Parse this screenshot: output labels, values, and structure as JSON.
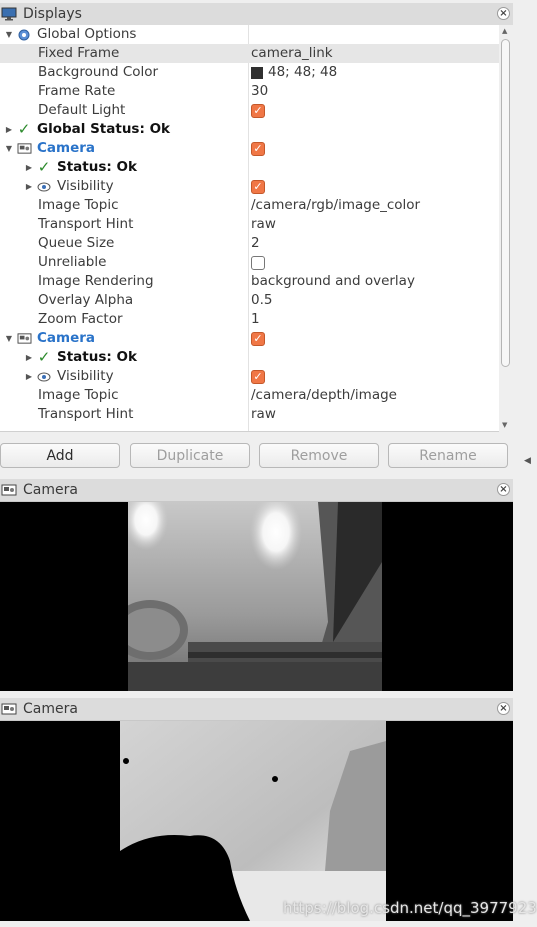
{
  "displays_panel": {
    "title": "Displays"
  },
  "tree": [
    {
      "indent": 0,
      "arrow": "▼",
      "icon": "gear-icon",
      "name": "Global Options",
      "value": ""
    },
    {
      "indent": 1,
      "name": "Fixed Frame",
      "value": "camera_link",
      "selected": true
    },
    {
      "indent": 1,
      "name": "Background Color",
      "value": "48; 48; 48",
      "swatch": "#303030"
    },
    {
      "indent": 1,
      "name": "Frame Rate",
      "value": "30"
    },
    {
      "indent": 1,
      "name": "Default Light",
      "check": true
    },
    {
      "indent": 0,
      "arrow": "▶",
      "icon": "checkmark-icon",
      "name": "Global Status: Ok",
      "style": "bold"
    },
    {
      "indent": 0,
      "arrow": "▼",
      "icon": "camera-display-icon",
      "name": "Camera",
      "style": "blue",
      "check": true
    },
    {
      "indent": 1,
      "arrow": "▶",
      "icon": "checkmark-icon",
      "name": "Status: Ok",
      "style": "bold"
    },
    {
      "indent": 1,
      "arrow": "▶",
      "icon": "eye-icon",
      "name": "Visibility",
      "check": true
    },
    {
      "indent": 1,
      "name": "Image Topic",
      "value": "/camera/rgb/image_color"
    },
    {
      "indent": 1,
      "name": "Transport Hint",
      "value": "raw"
    },
    {
      "indent": 1,
      "name": "Queue Size",
      "value": "2"
    },
    {
      "indent": 1,
      "name": "Unreliable",
      "check": false
    },
    {
      "indent": 1,
      "name": "Image Rendering",
      "value": "background and overlay"
    },
    {
      "indent": 1,
      "name": "Overlay Alpha",
      "value": "0.5"
    },
    {
      "indent": 1,
      "name": "Zoom Factor",
      "value": "1"
    },
    {
      "indent": 0,
      "arrow": "▼",
      "icon": "camera-display-icon",
      "name": "Camera",
      "style": "blue",
      "check": true
    },
    {
      "indent": 1,
      "arrow": "▶",
      "icon": "checkmark-icon",
      "name": "Status: Ok",
      "style": "bold"
    },
    {
      "indent": 1,
      "arrow": "▶",
      "icon": "eye-icon",
      "name": "Visibility",
      "check": true
    },
    {
      "indent": 1,
      "name": "Image Topic",
      "value": "/camera/depth/image"
    },
    {
      "indent": 1,
      "name": "Transport Hint",
      "value": "raw"
    }
  ],
  "buttons": {
    "add": "Add",
    "duplicate": "Duplicate",
    "remove": "Remove",
    "rename": "Rename"
  },
  "camera_panel_1": {
    "title": "Camera"
  },
  "camera_panel_2": {
    "title": "Camera"
  },
  "watermark": "https://blog.csdn.net/qq_3977923",
  "colors": {
    "checkbox_on": "#f07746",
    "camera_label": "#2a73c9",
    "status_ok": "#2b8a2b",
    "background_swatch": "#303030"
  }
}
